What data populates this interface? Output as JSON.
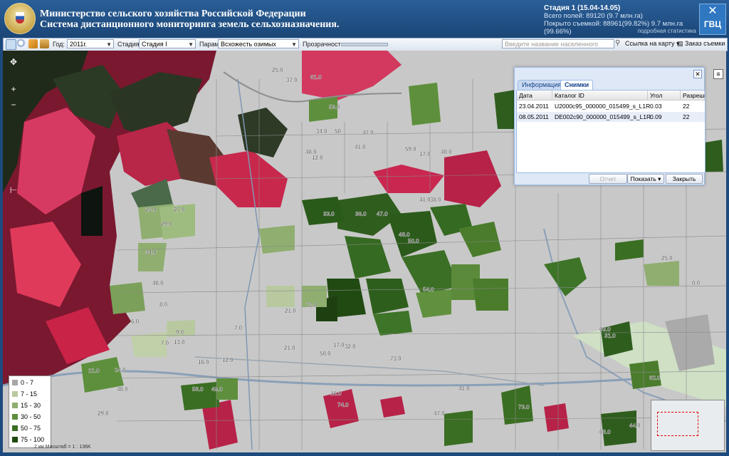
{
  "header": {
    "title_line1": "Министерство сельского хозяйства Российской Федерации",
    "title_line2": "Система дистанционного мониторинга земель сельхозназначения.",
    "stage": "Стадия 1 (15.04-14.05)",
    "total_fields": "Всего полей: 89120 (9.7 млн.га)",
    "coverage": "Покрыто съемкой: 88961(99.82%) 9.7 млн.га (99.66%)",
    "stats_link": "подробная статистика",
    "brand": "ГВЦ"
  },
  "toolbar": {
    "year_label": "Год:",
    "year_value": "2011г.",
    "stage_label": "Стадия:",
    "stage_value": "Стадия I",
    "param_label": "Параметр:",
    "param_value": "Всхожесть озимых",
    "opacity_label": "Прозрачность:",
    "search_placeholder": "Введите название населенного пункта",
    "map_link": "Ссылка на карту",
    "order": "Заказ съемки"
  },
  "legend": [
    {
      "label": "0 - 7",
      "color": "#a6a6a6"
    },
    {
      "label": "7 - 15",
      "color": "#b8c9a0"
    },
    {
      "label": "15 - 30",
      "color": "#8fae70"
    },
    {
      "label": "30 - 50",
      "color": "#5e8f3c"
    },
    {
      "label": "50 - 75",
      "color": "#3a6e22"
    },
    {
      "label": "75 - 100",
      "color": "#1e4a10"
    }
  ],
  "scale": "2 км  Масштаб = 1 : 136K",
  "dialog": {
    "tab_info": "Информация",
    "tab_images": "Снимки",
    "columns": [
      "Дата",
      "Каталог ID",
      "Угол",
      "Разрешен"
    ],
    "rows": [
      [
        "23.04.2011",
        "U2000c95_000000_015499_s_L1R",
        "0.03",
        "22"
      ],
      [
        "08.05.2011",
        "DE002c90_000000_015499_s_L1R",
        "0.09",
        "22"
      ]
    ],
    "btn_report": "Отчет",
    "btn_show": "Показать",
    "btn_close": "Закрыть"
  },
  "field_labels": [
    "25.0",
    "37.0",
    "61.0",
    "53.0",
    "50",
    "34.0",
    "48.0",
    "12.0",
    "47.0",
    "41.0",
    "59.0",
    "17.0",
    "40.0",
    "41.0",
    "38.0",
    "27.0",
    "23.0",
    "29.0",
    "34.0",
    "48.0",
    "33.0",
    "36.0",
    "47.0",
    "48.0",
    "50.0",
    "54.0",
    "8.0",
    "6.0",
    "21.0",
    "73.0",
    "17.0",
    "50.0",
    "32.0",
    "73.0",
    "21.0",
    "9.0",
    "13.0",
    "7.0",
    "7.0",
    "16.0",
    "12.0",
    "21.0",
    "24.0",
    "48.0",
    "29.0",
    "58.0",
    "49.0",
    "18.0",
    "74.0",
    "47.0",
    "41.0",
    "73.0",
    "68.0",
    "44.0",
    "62.0",
    "31.0",
    "69.0",
    "25.0",
    "0.0"
  ]
}
